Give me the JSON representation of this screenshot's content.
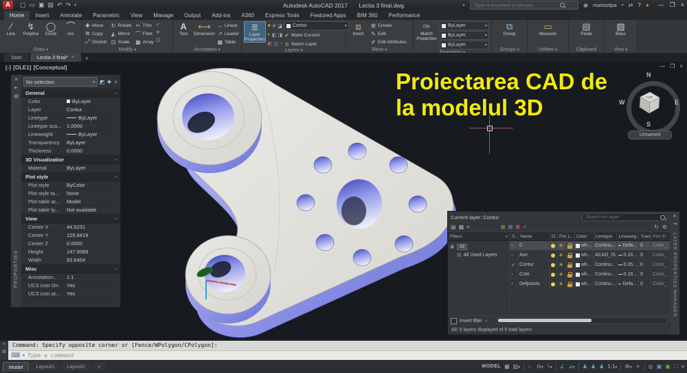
{
  "icons": {
    "chevron_down": "▾",
    "collapse": "«",
    "minus": "−",
    "search_arrow": "▸"
  },
  "titlebar": {
    "app_title": "Autodesk AutoCAD 2017",
    "doc_title": "Lectia 3 final.dwg",
    "search_placeholder": "Type a keyword or phrase",
    "user": "mariustipa"
  },
  "ribbon_tabs": [
    {
      "label": "Home",
      "cls": "active"
    },
    {
      "label": "Insert",
      "cls": ""
    },
    {
      "label": "Annotate",
      "cls": ""
    },
    {
      "label": "Parametric",
      "cls": ""
    },
    {
      "label": "View",
      "cls": ""
    },
    {
      "label": "Manage",
      "cls": ""
    },
    {
      "label": "Output",
      "cls": ""
    },
    {
      "label": "Add-ins",
      "cls": ""
    },
    {
      "label": "A360",
      "cls": ""
    },
    {
      "label": "Express Tools",
      "cls": ""
    },
    {
      "label": "Featured Apps",
      "cls": ""
    },
    {
      "label": "BIM 360",
      "cls": ""
    },
    {
      "label": "Performance",
      "cls": ""
    }
  ],
  "ribbon": {
    "draw": {
      "label": "Draw",
      "buttons": [
        {
          "label": "Line",
          "icon": "∕",
          "iconname": "line-icon"
        },
        {
          "label": "Polyline",
          "icon": "↯",
          "iconname": "polyline-icon"
        },
        {
          "label": "Circle",
          "icon": "◯",
          "iconname": "circle-icon"
        },
        {
          "label": "Arc",
          "icon": "⌒",
          "iconname": "arc-icon"
        }
      ]
    },
    "modify": {
      "label": "Modify",
      "buttons": [
        {
          "label": "Move",
          "icon": "✚",
          "iconname": "move-icon"
        },
        {
          "label": "Copy",
          "icon": "⧉",
          "iconname": "copy-icon"
        },
        {
          "label": "Stretch",
          "icon": "⤢",
          "iconname": "stretch-icon"
        },
        {
          "label": "Rotate",
          "icon": "↻",
          "iconname": "rotate-icon"
        },
        {
          "label": "Mirror",
          "icon": "◭",
          "iconname": "mirror-icon"
        },
        {
          "label": "Scale",
          "icon": "⊡",
          "iconname": "scale-icon"
        },
        {
          "label": "Trim",
          "icon": "✂",
          "iconname": "trim-icon"
        },
        {
          "label": "Fillet",
          "icon": "⌒",
          "iconname": "fillet-icon"
        },
        {
          "label": "Array",
          "icon": "▦",
          "iconname": "array-icon"
        }
      ]
    },
    "annotation": {
      "label": "Annotation",
      "text_label": "Text",
      "dimension_label": "Dimension",
      "small": [
        {
          "label": "Linear",
          "icon": "↔",
          "iconname": "linear-dimension-icon"
        },
        {
          "label": "Leader",
          "icon": "↗",
          "iconname": "leader-icon"
        },
        {
          "label": "Table",
          "icon": "▦",
          "iconname": "table-icon"
        }
      ]
    },
    "layers": {
      "label": "Layers",
      "big_label": "Layer Properties",
      "dropdown_value": "Contur",
      "make_current": "Make Current",
      "match_layer": "Match Layer"
    },
    "block": {
      "label": "Block",
      "big_label": "Insert",
      "small": [
        {
          "label": "Create",
          "icon": "⊞",
          "iconname": "create-block-icon"
        },
        {
          "label": "Edit",
          "icon": "✎",
          "iconname": "edit-block-icon"
        },
        {
          "label": "Edit Attributes",
          "icon": "✐",
          "iconname": "edit-attributes-icon"
        }
      ]
    },
    "properties": {
      "label": "Properties",
      "big_label": "Match Properties",
      "rows": [
        {
          "value": "ByLayer",
          "kind": "swatch"
        },
        {
          "value": "ByLayer",
          "kind": "line"
        },
        {
          "value": "ByLayer",
          "kind": "line"
        }
      ]
    },
    "groups": {
      "label": "Groups",
      "big_label": "Group"
    },
    "utilities": {
      "label": "Utilities",
      "big_label": "Measure"
    },
    "clipboard": {
      "label": "Clipboard",
      "big_label": "Paste"
    },
    "view": {
      "label": "View",
      "big_label": "Base"
    }
  },
  "file_tabs": [
    {
      "label": "Start",
      "cls": ""
    },
    {
      "label": "Lectia 3 final*",
      "cls": "active"
    }
  ],
  "viewport": {
    "vp_controls": "[-]",
    "vp_view": "[OLE1]",
    "vp_visual": "[Conceptual]"
  },
  "viewcube": {
    "n": "N",
    "s": "S",
    "e": "E",
    "w": "W",
    "cube_face": "TOP",
    "named_view": "Unnamed"
  },
  "overlay": {
    "line1": "Proiectarea CAD de",
    "line2": "la modelul 3D"
  },
  "properties_palette": {
    "title": "PROPERTIES",
    "selector_value": "No selection",
    "rows": [
      {
        "cls": "sec",
        "label": "General",
        "value": ""
      },
      {
        "cls": "swatch",
        "label": "Color",
        "value": "ByLayer"
      },
      {
        "cls": "",
        "label": "Layer",
        "value": "Contur"
      },
      {
        "cls": "line",
        "label": "Linetype",
        "value": "ByLayer"
      },
      {
        "cls": "",
        "label": "Linetype sca...",
        "value": "1.0000"
      },
      {
        "cls": "line",
        "label": "Lineweight",
        "value": "ByLayer"
      },
      {
        "cls": "",
        "label": "Transparency",
        "value": "ByLayer"
      },
      {
        "cls": "",
        "label": "Thickness",
        "value": "0.0000"
      },
      {
        "cls": "sec",
        "label": "3D Visualization",
        "value": ""
      },
      {
        "cls": "",
        "label": "Material",
        "value": "ByLayer"
      },
      {
        "cls": "sec",
        "label": "Plot style",
        "value": ""
      },
      {
        "cls": "",
        "label": "Plot style",
        "value": "ByColor"
      },
      {
        "cls": "",
        "label": "Plot style ta...",
        "value": "None"
      },
      {
        "cls": "",
        "label": "Plot table at...",
        "value": "Model"
      },
      {
        "cls": "",
        "label": "Plot table ty...",
        "value": "Not available"
      },
      {
        "cls": "sec",
        "label": "View",
        "value": ""
      },
      {
        "cls": "",
        "label": "Center X",
        "value": "44.5231"
      },
      {
        "cls": "",
        "label": "Center Y",
        "value": "129.6419"
      },
      {
        "cls": "",
        "label": "Center Z",
        "value": "0.0000"
      },
      {
        "cls": "",
        "label": "Height",
        "value": "147.0089"
      },
      {
        "cls": "",
        "label": "Width",
        "value": "93.6454"
      },
      {
        "cls": "sec",
        "label": "Misc",
        "value": ""
      },
      {
        "cls": "",
        "label": "Annotation...",
        "value": "1:1"
      },
      {
        "cls": "",
        "label": "UCS icon On",
        "value": "Yes"
      },
      {
        "cls": "",
        "label": "UCS icon at...",
        "value": "Yes"
      }
    ]
  },
  "layer_palette": {
    "title": "LAYER PROPERTIES MANAGER",
    "current_layer": "Current layer: Contur",
    "search_placeholder": "Search for layer",
    "filters_label": "Filters",
    "tree": {
      "all": "All",
      "all_used": "All Used Layers"
    },
    "columns": {
      "status": "S..",
      "name": "Name",
      "on": "O..",
      "freeze": "Fre...",
      "lock": "L...",
      "color": "Color",
      "linetype": "Linetype",
      "lineweight": "Lineweig...",
      "transparency": "Trans...",
      "plot_style": "Plot St"
    },
    "rows": [
      {
        "cls": "sel",
        "st": "▫",
        "stc": "",
        "name": "0",
        "color": "wh...",
        "linetype": "Continu...",
        "lineweight": "Defa...",
        "trans": "0",
        "plot": "Color_"
      },
      {
        "cls": "",
        "st": "▫",
        "stc": "",
        "name": "Axe",
        "color": "wh...",
        "linetype": "ACAD_IS...",
        "lineweight": "0.18...",
        "trans": "0",
        "plot": "Color_"
      },
      {
        "cls": "",
        "st": "✓",
        "stc": "cur",
        "name": "Contur",
        "color": "wh...",
        "linetype": "Continu...",
        "lineweight": "0.35...",
        "trans": "0",
        "plot": "Color_"
      },
      {
        "cls": "",
        "st": "▫",
        "stc": "",
        "name": "Cote",
        "color": "wh...",
        "linetype": "Continu...",
        "lineweight": "0.18...",
        "trans": "0",
        "plot": "Color_"
      },
      {
        "cls": "",
        "st": "▫",
        "stc": "",
        "name": "Defpoints",
        "color": "wh...",
        "linetype": "Continu...",
        "lineweight": "Defa...",
        "trans": "0",
        "plot": "Color_"
      }
    ],
    "invert_filter": "Invert filter",
    "status_text": "All: 5 layers displayed of 5 total layers"
  },
  "command": {
    "history": "Command: Specify opposite corner or [Fence/WPolygon/CPolygon]:",
    "placeholder": "Type a command"
  },
  "layout_tabs": [
    {
      "label": "Model",
      "cls": "active"
    },
    {
      "label": "Layout1",
      "cls": ""
    },
    {
      "label": "Layout2",
      "cls": ""
    },
    {
      "label": "+",
      "cls": ""
    }
  ],
  "statusbar": {
    "model_label": "MODEL",
    "annotation_scale": "1:1"
  },
  "colors": {
    "overlay_yellow": "#f2ea0c",
    "model_side_blue": "#7b82e0",
    "plate_gray": "#e2e1dd",
    "canvas_bg": "#171a1f",
    "ribbon_highlight": "#41637e"
  }
}
